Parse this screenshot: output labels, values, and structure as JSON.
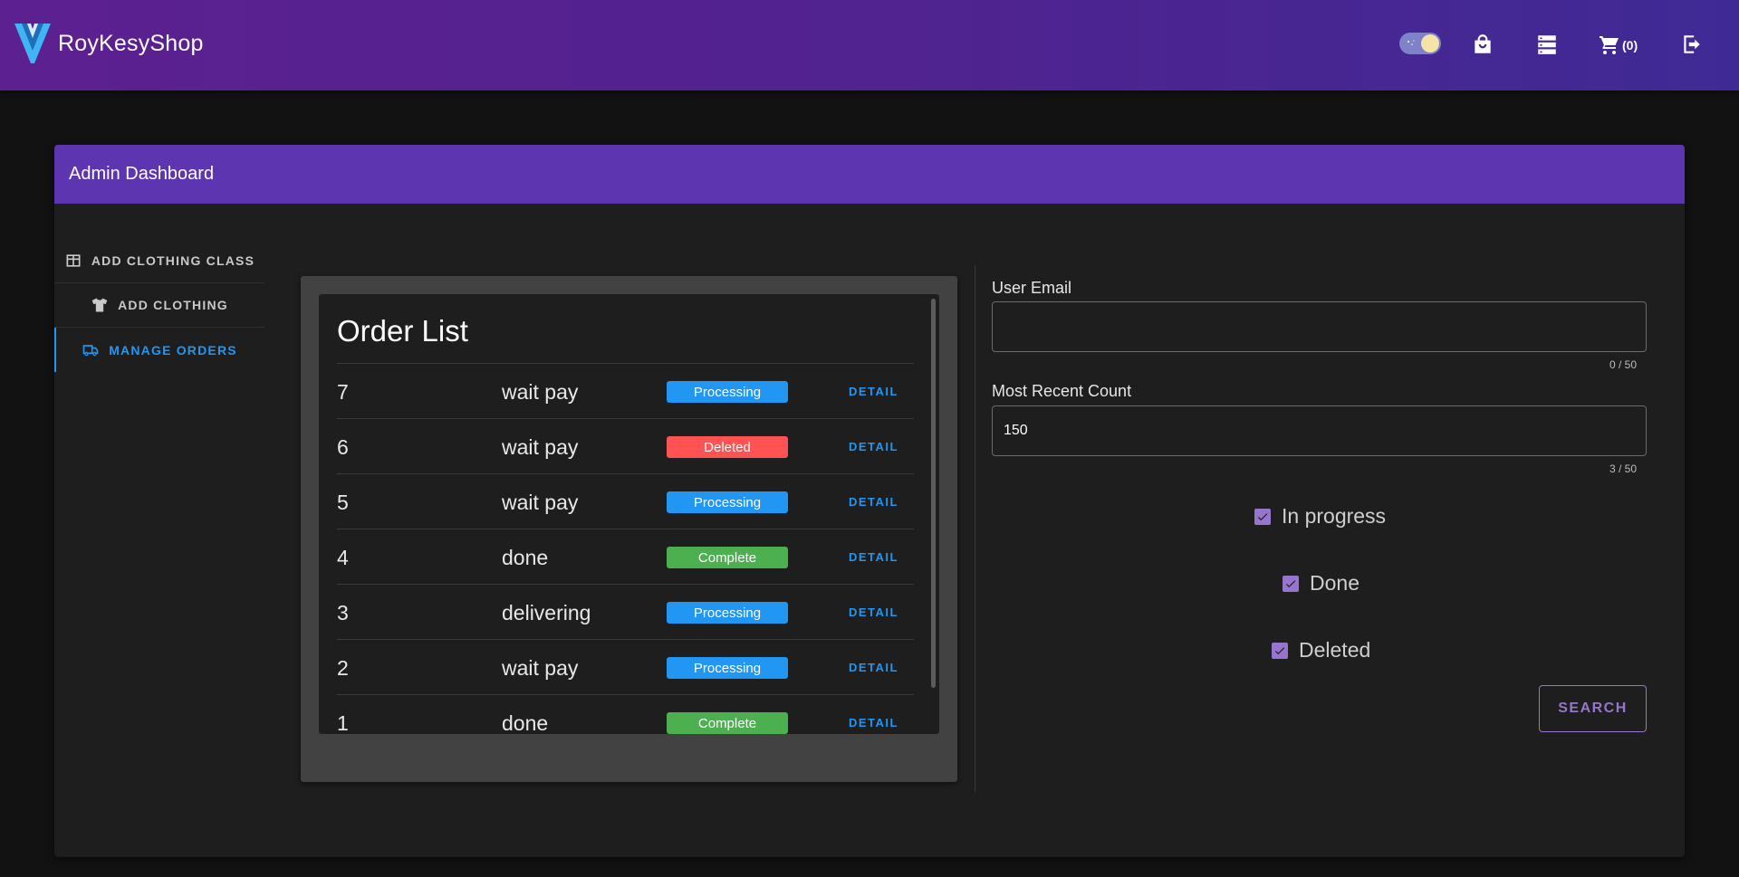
{
  "appbar": {
    "brand_name": "RoyKesyShop",
    "cart_count": "(0)",
    "icons": [
      "logo-v-icon",
      "theme-toggle",
      "shopping-bag-icon",
      "storage-icon",
      "cart-icon",
      "logout-icon"
    ]
  },
  "card": {
    "title": "Admin Dashboard"
  },
  "sidebar": {
    "items": [
      {
        "label": "ADD CLOTHING CLASS",
        "icon": "table-icon",
        "active": false
      },
      {
        "label": "ADD CLOTHING",
        "icon": "tshirt-icon",
        "active": false
      },
      {
        "label": "MANAGE ORDERS",
        "icon": "truck-icon",
        "active": true
      }
    ]
  },
  "orders": {
    "title": "Order List",
    "detail_label": "DETAIL",
    "rows": [
      {
        "id": "7",
        "status": "wait pay",
        "chip": "Processing",
        "chip_color": "#2196f3"
      },
      {
        "id": "6",
        "status": "wait pay",
        "chip": "Deleted",
        "chip_color": "#ff5252"
      },
      {
        "id": "5",
        "status": "wait pay",
        "chip": "Processing",
        "chip_color": "#2196f3"
      },
      {
        "id": "4",
        "status": "done",
        "chip": "Complete",
        "chip_color": "#4caf50"
      },
      {
        "id": "3",
        "status": "delivering",
        "chip": "Processing",
        "chip_color": "#2196f3"
      },
      {
        "id": "2",
        "status": "wait pay",
        "chip": "Processing",
        "chip_color": "#2196f3"
      },
      {
        "id": "1",
        "status": "done",
        "chip": "Complete",
        "chip_color": "#4caf50"
      }
    ]
  },
  "filters": {
    "email_label": "User Email",
    "email_value": "",
    "email_counter": "0 / 50",
    "count_label": "Most Recent Count",
    "count_value": "150",
    "count_counter": "3 / 50",
    "checkboxes": [
      {
        "label": "In progress",
        "checked": true
      },
      {
        "label": "Done",
        "checked": true
      },
      {
        "label": "Deleted",
        "checked": true
      }
    ],
    "search_label": "SEARCH"
  },
  "colors": {
    "appbar_start": "#5d2090",
    "appbar_end": "#3f2a95",
    "card_header": "#5e35b1",
    "accent_blue": "#2196f3",
    "accent_purple": "#9575cd"
  }
}
